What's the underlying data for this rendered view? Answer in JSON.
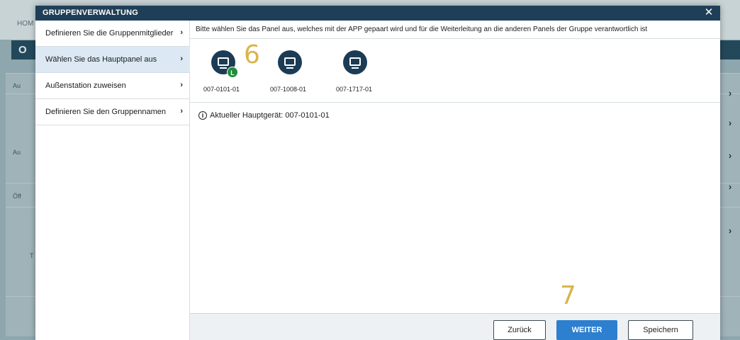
{
  "background": {
    "breadcrumb": "HOM",
    "header_letter": "O",
    "labels": [
      "Au",
      "Au",
      "Öff",
      "T"
    ]
  },
  "modal": {
    "title": "GRUPPENVERWALTUNG",
    "close_symbol": "✕"
  },
  "sidebar": {
    "items": [
      {
        "label": "Definieren Sie die Gruppenmitglieder",
        "active": false
      },
      {
        "label": "Wählen Sie das Hauptpanel aus",
        "active": true
      },
      {
        "label": "Außenstation zuweisen",
        "active": false
      },
      {
        "label": "Definieren Sie den Gruppennamen",
        "active": false
      }
    ],
    "chevron": "›"
  },
  "content": {
    "instruction": "Bitte wählen Sie das Panel aus, welches mit der APP gepaart wird und für die Weiterleitung an die anderen Panels der Gruppe verantwortlich ist",
    "panels": [
      {
        "id": "007-0101-01",
        "badge": "L"
      },
      {
        "id": "007-1008-01",
        "badge": ""
      },
      {
        "id": "007-1717-01",
        "badge": ""
      }
    ],
    "info_symbol": "i",
    "current_main": "Aktueller Hauptgerät: 007-0101-01"
  },
  "annotations": {
    "step6": "6",
    "step7": "7"
  },
  "footer": {
    "back_label": "Zurück",
    "next_label": "WEITER",
    "save_label": "Speichern"
  },
  "colors": {
    "title_bar": "#1f3e57",
    "panel_icon": "#1c3b55",
    "badge_green": "#1f8d3a",
    "primary_button": "#2d7fcf",
    "annotation": "#d9b54a"
  }
}
